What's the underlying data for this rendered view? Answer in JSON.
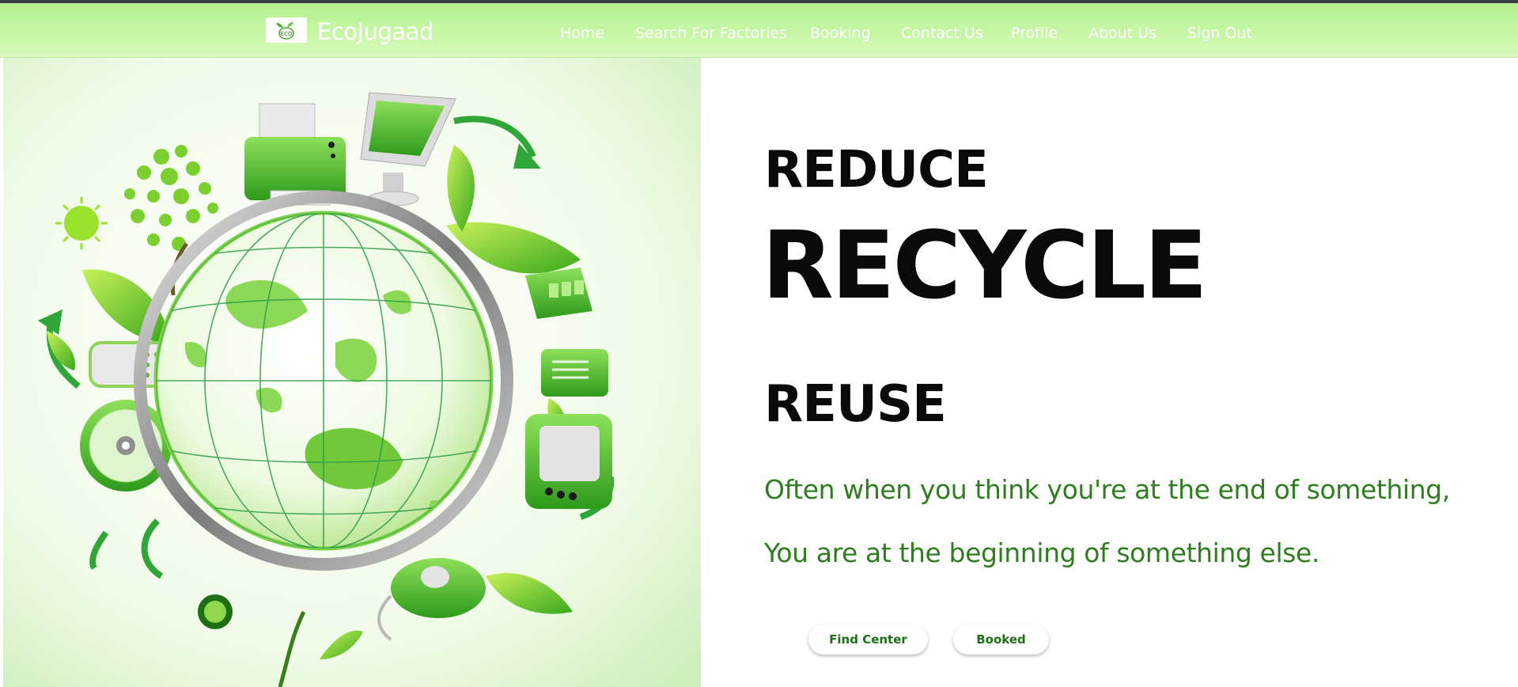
{
  "navbar": {
    "logo_text": "ECO",
    "brand": "EcoJugaad",
    "items": [
      {
        "label": "Home"
      },
      {
        "label": "Search For Factories"
      },
      {
        "label": "Booking"
      },
      {
        "label": "Contact Us"
      },
      {
        "label": "Profile"
      },
      {
        "label": "About Us"
      },
      {
        "label": "Sign Out"
      }
    ]
  },
  "hero": {
    "image_icon": "eco-recycling-globe-illustration",
    "line1": "REDUCE",
    "line2": "RECYCLE",
    "line3": "REUSE",
    "quote_line1": "Often when you think you're at the end of something,",
    "quote_line2": "You are at the beginning of something else.",
    "buttons": {
      "find_center": "Find Center",
      "booked": "Booked"
    }
  },
  "colors": {
    "navbar": "#b8f394",
    "quote_text": "#2e7d1f",
    "button_text": "#1f6e15",
    "heading_text": "#0a0a0a"
  }
}
